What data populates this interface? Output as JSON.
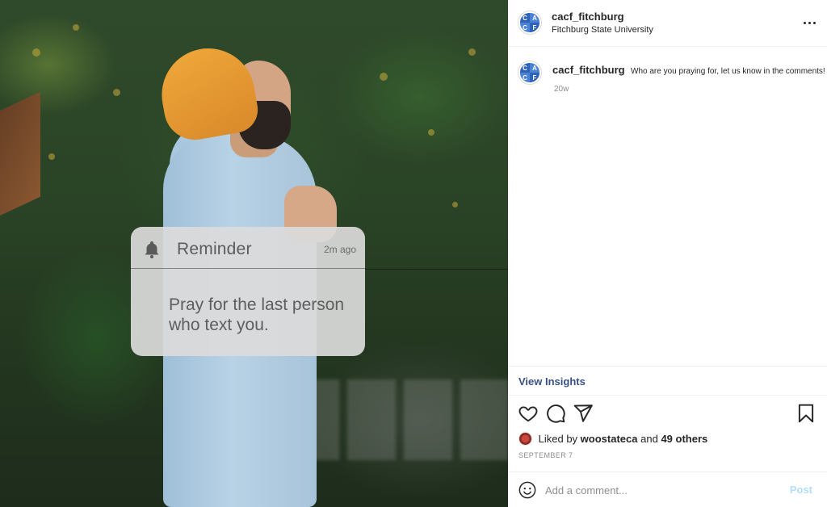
{
  "post": {
    "username": "cacf_fitchburg",
    "location": "Fitchburg State University",
    "avatar_text": {
      "tl": "C",
      "tr": "A",
      "bl": "C",
      "br": "F"
    }
  },
  "image": {
    "reminder_title": "Reminder",
    "reminder_time": "2m ago",
    "reminder_body": "Pray for the last person who text you."
  },
  "caption": {
    "username": "cacf_fitchburg",
    "text": "Who are you praying for, let us know in the comments!",
    "age": "20w"
  },
  "insights": {
    "label": "View Insights"
  },
  "likes": {
    "prefix": "Liked by",
    "user": "woostateca",
    "joiner": "and",
    "others": "49 others"
  },
  "date": "SEPTEMBER 7",
  "comment": {
    "placeholder": "Add a comment...",
    "post_label": "Post"
  },
  "icons": {
    "more": "more-options-icon",
    "like": "heart-icon",
    "comment": "comment-bubble-icon",
    "share": "paper-plane-icon",
    "save": "bookmark-icon",
    "emoji": "emoji-icon",
    "bell": "bell-icon"
  },
  "colors": {
    "link": "#385185",
    "muted": "#8e8e8e",
    "post_disabled": "#b2dffc",
    "avatar_blue": "#3b6fc7"
  }
}
